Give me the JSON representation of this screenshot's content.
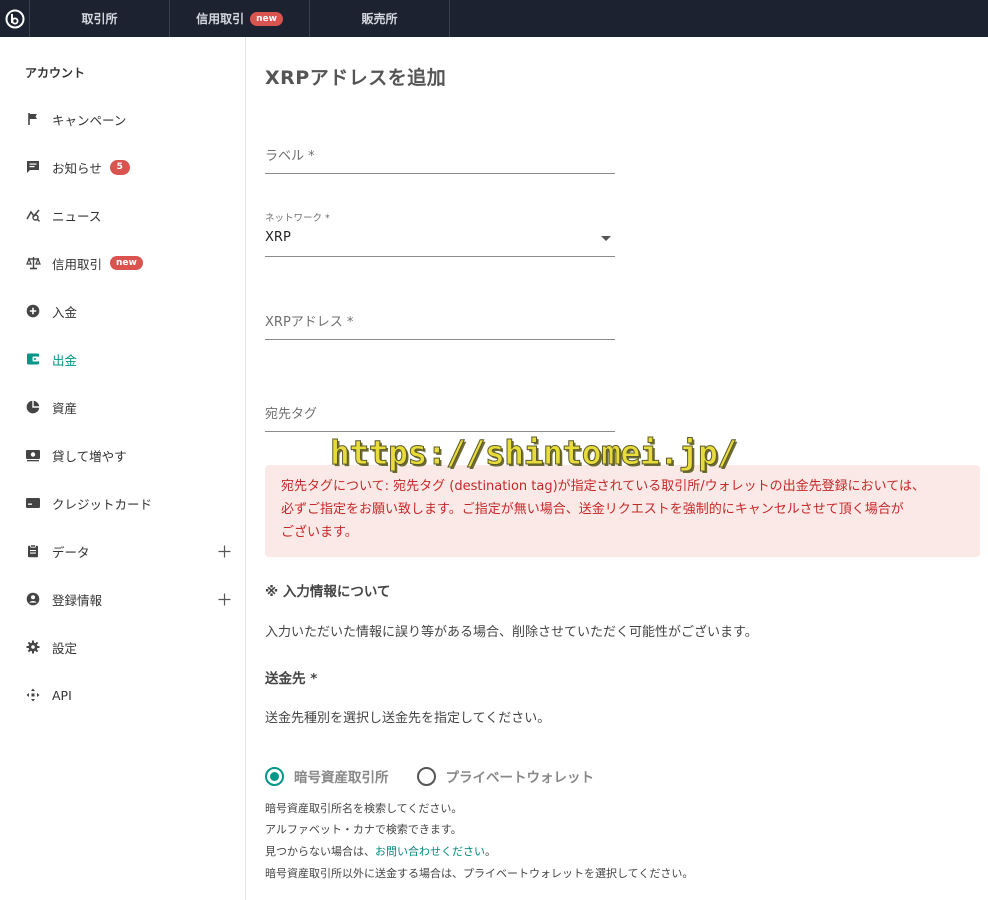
{
  "topnav": {
    "items": [
      {
        "label": "取引所"
      },
      {
        "label": "信用取引",
        "badge": "new"
      },
      {
        "label": "販売所"
      }
    ]
  },
  "sidebar": {
    "title": "アカウント",
    "items": [
      {
        "label": "キャンペーン",
        "icon": "flag-icon"
      },
      {
        "label": "お知らせ",
        "icon": "message-icon",
        "count": "5"
      },
      {
        "label": "ニュース",
        "icon": "news-icon"
      },
      {
        "label": "信用取引",
        "icon": "scale-icon",
        "badge": "new"
      },
      {
        "label": "入金",
        "icon": "plus-circle-icon"
      },
      {
        "label": "出金",
        "icon": "wallet-icon",
        "active": true
      },
      {
        "label": "資産",
        "icon": "pie-chart-icon"
      },
      {
        "label": "貸して増やす",
        "icon": "money-icon"
      },
      {
        "label": "クレジットカード",
        "icon": "credit-card-icon"
      },
      {
        "label": "データ",
        "icon": "clipboard-icon",
        "expandable": true
      },
      {
        "label": "登録情報",
        "icon": "account-icon",
        "expandable": true
      },
      {
        "label": "設定",
        "icon": "gear-icon"
      },
      {
        "label": "API",
        "icon": "api-icon"
      }
    ]
  },
  "main": {
    "title": "XRPアドレスを追加",
    "label_field": {
      "placeholder": "ラベル *"
    },
    "network_field": {
      "label": "ネットワーク *",
      "value": "XRP"
    },
    "address_field": {
      "placeholder": "XRPアドレス *"
    },
    "tag_field": {
      "placeholder": "宛先タグ"
    },
    "alert": {
      "line1": "宛先タグについて: 宛先タグ (destination tag)が指定されている取引所/ウォレットの出金先登録においては、",
      "line2": "必ずご指定をお願い致します。ご指定が無い場合、送金リクエストを強制的にキャンセルさせて頂く場合が",
      "line3": "ございます。"
    },
    "input_info_heading": "※ 入力情報について",
    "input_info_text": "入力いただいた情報に誤り等がある場合、削除させていただく可能性がございます。",
    "destination_heading": "送金先 *",
    "destination_text": "送金先種別を選択し送金先を指定してください。",
    "radio_exchange": "暗号資産取引所",
    "radio_wallet": "プライベートウォレット",
    "hint1": "暗号資産取引所名を検索してください。",
    "hint2": "アルファベット・カナで検索できます。",
    "hint3_prefix": "見つからない場合は、",
    "hint3_link": "お問い合わせください",
    "hint3_suffix": "。",
    "hint4": "暗号資産取引所以外に送金する場合は、プライベートウォレットを選択してください。"
  },
  "watermark": "https://shintomei.jp/",
  "colors": {
    "accent": "#009688",
    "alert_bg": "#fbe9e8",
    "alert_text": "#c62828",
    "topbar": "#1c2230",
    "badge": "#d9534f"
  }
}
